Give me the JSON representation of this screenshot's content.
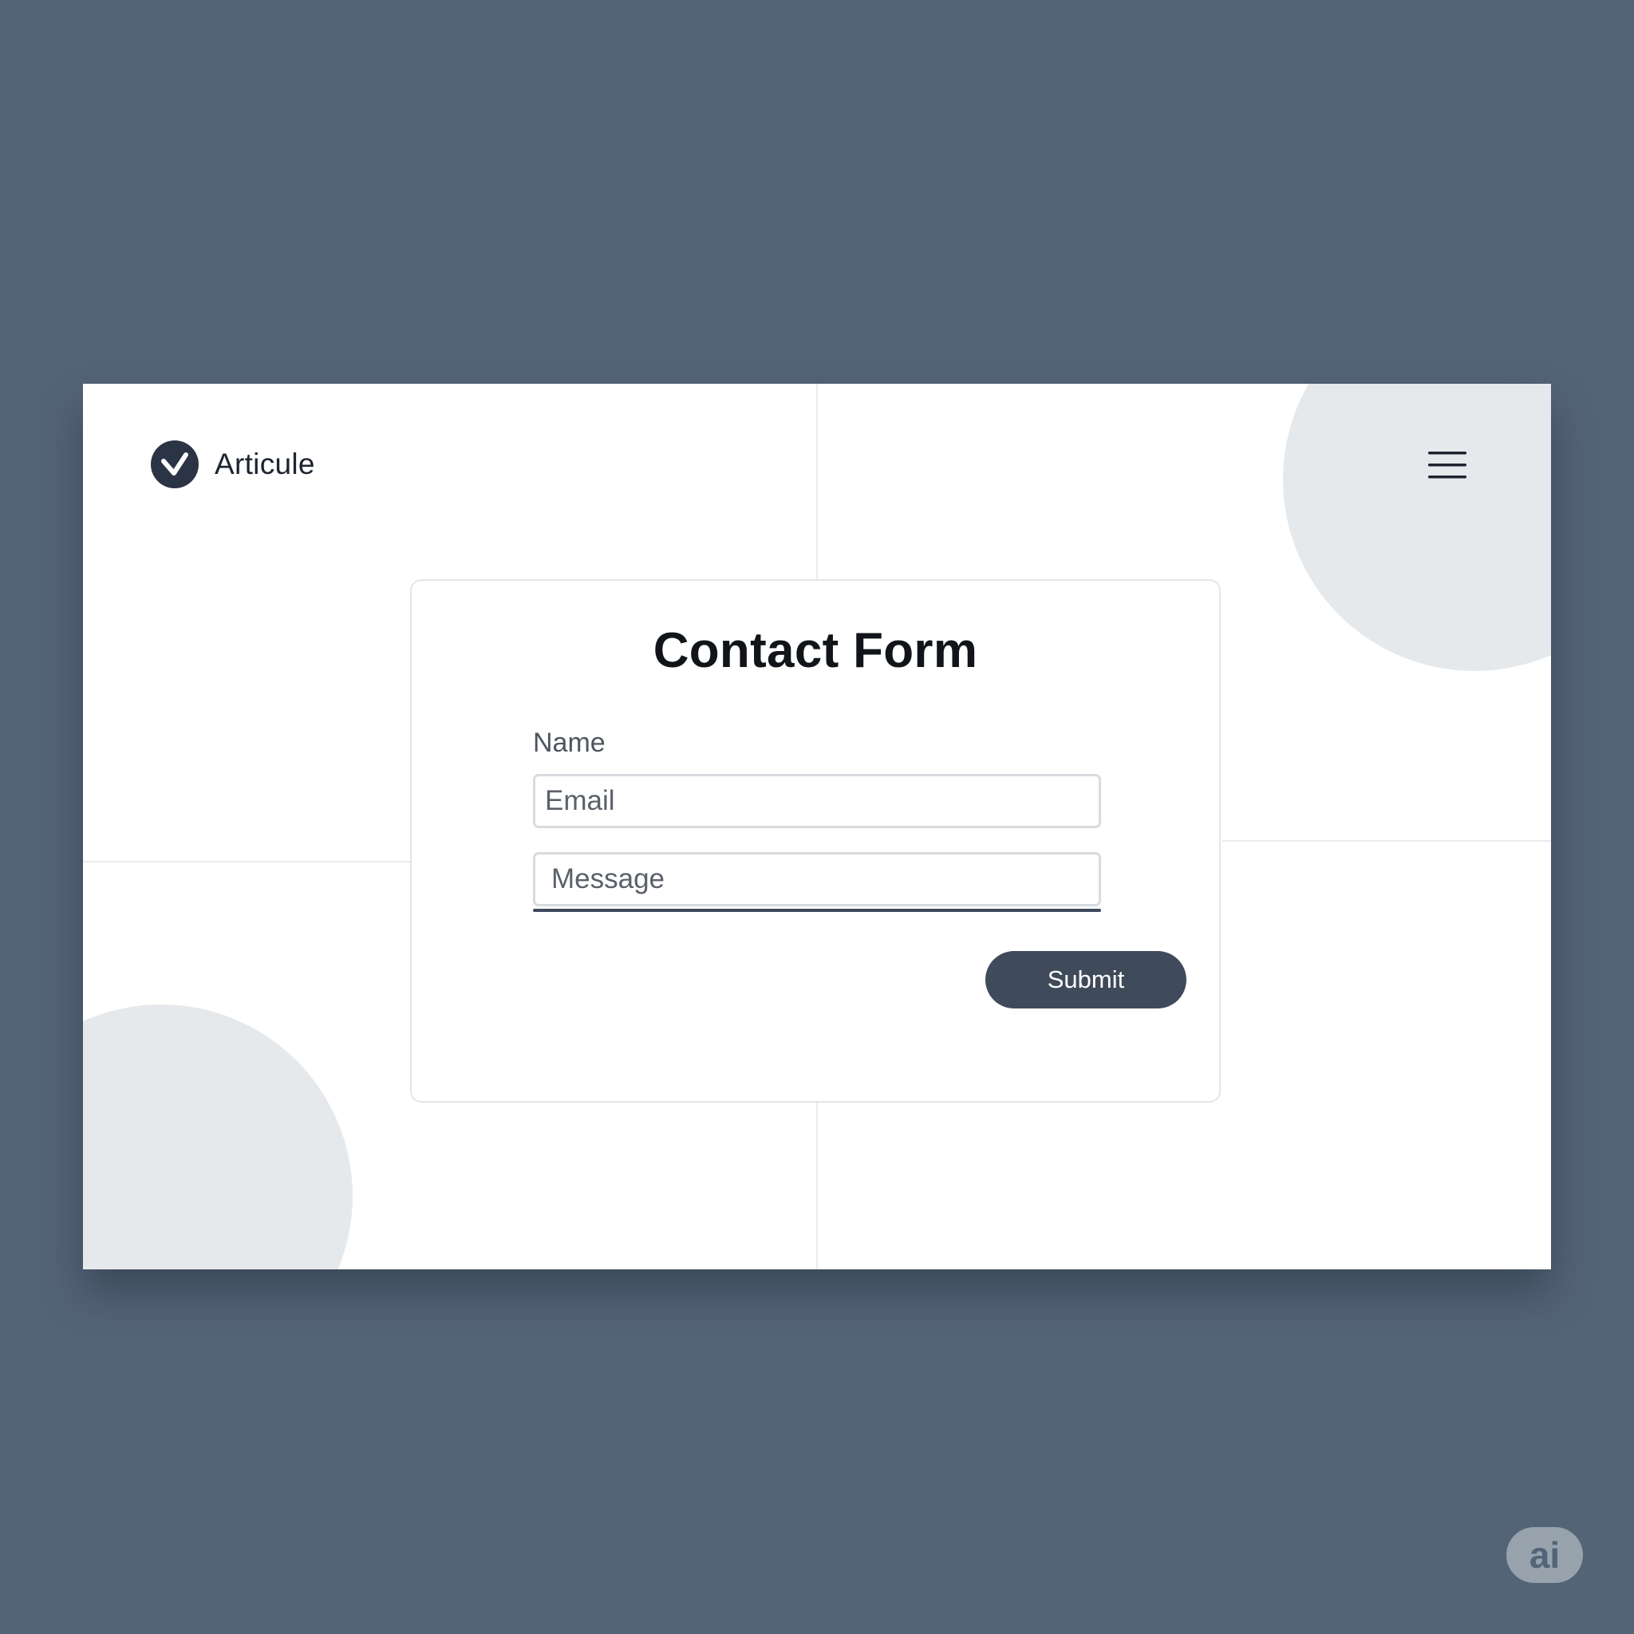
{
  "brand": {
    "name": "Articule",
    "logo_icon": "checkmark-circle-icon"
  },
  "header": {
    "menu_icon": "hamburger-menu-icon"
  },
  "form": {
    "title": "Contact Form",
    "name_label": "Name",
    "email_placeholder": "Email",
    "message_placeholder": "Message",
    "submit_label": "Submit"
  },
  "badge": {
    "text": "ai"
  },
  "colors": {
    "background": "#546477",
    "accent": "#3f4a5b",
    "card_border": "#e3e5e8",
    "decoration": "#e6e9ec"
  }
}
